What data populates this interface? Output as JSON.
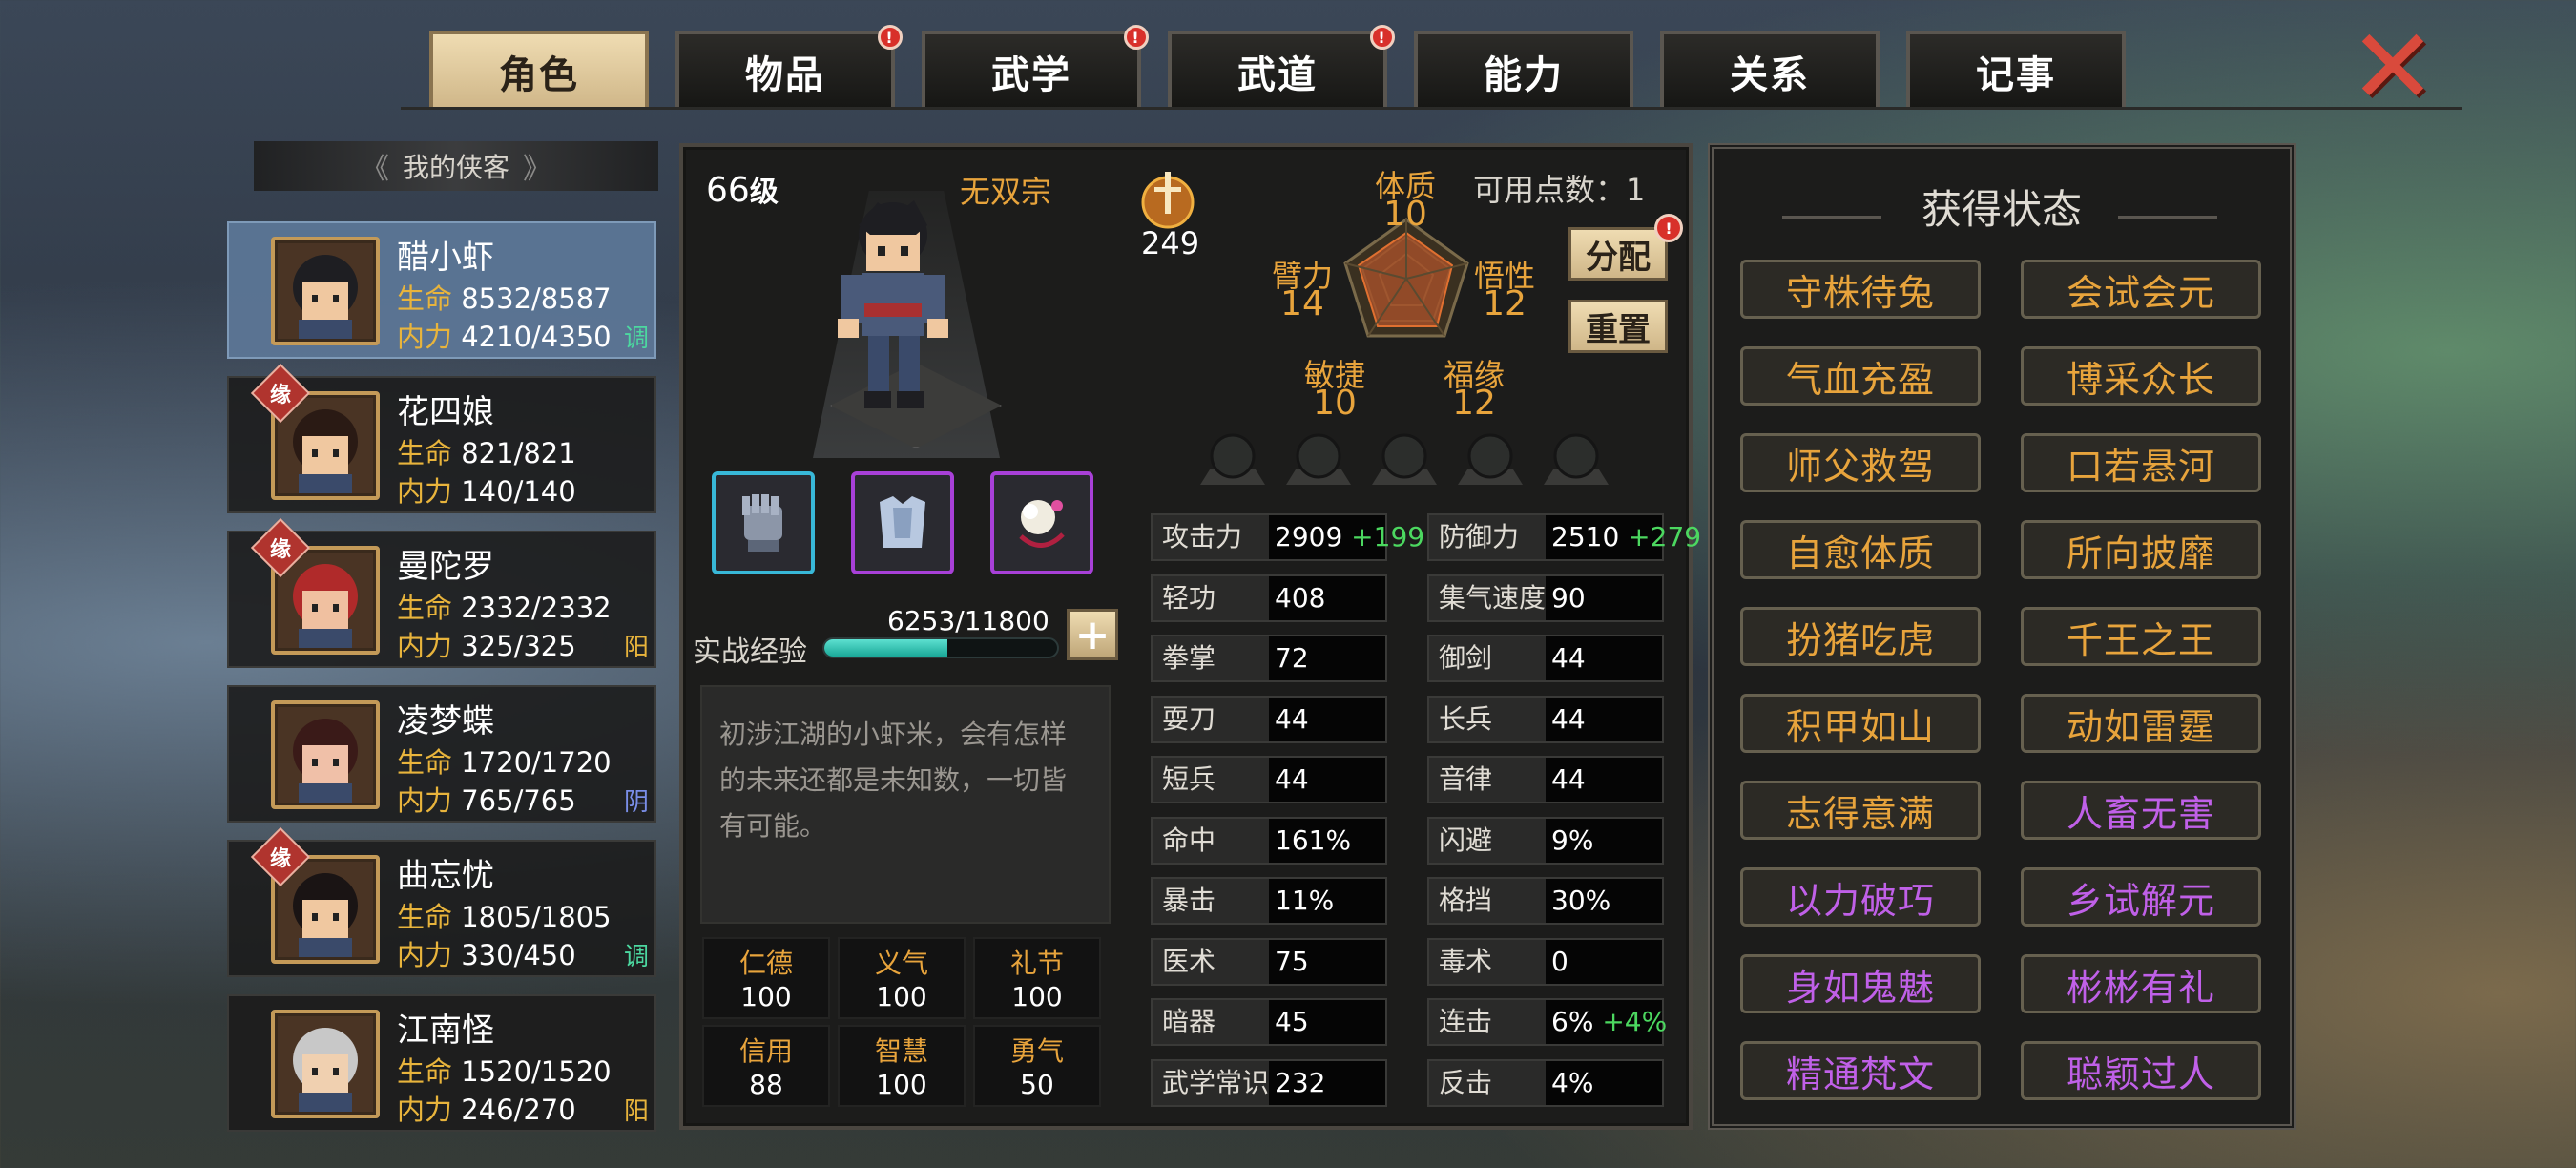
{
  "tabs": [
    {
      "label": "角色",
      "active": true,
      "badge": false
    },
    {
      "label": "物品",
      "active": false,
      "badge": true
    },
    {
      "label": "武学",
      "active": false,
      "badge": true
    },
    {
      "label": "武道",
      "active": false,
      "badge": true
    },
    {
      "label": "能力",
      "active": false,
      "badge": false
    },
    {
      "label": "关系",
      "active": false,
      "badge": false
    },
    {
      "label": "记事",
      "active": false,
      "badge": false
    }
  ],
  "badge_mark": "!",
  "roster": {
    "header": "我的侠客",
    "hp_label": "生命",
    "mp_label": "内力",
    "fate_label": "缘",
    "characters": [
      {
        "name": "醋小虾",
        "hp": "8532/8587",
        "mp": "4210/4350",
        "tag": "调",
        "tag_color": "#4cd8a0",
        "fate": false,
        "active": true
      },
      {
        "name": "花四娘",
        "hp": "821/821",
        "mp": "140/140",
        "tag": "",
        "tag_color": "",
        "fate": true,
        "active": false
      },
      {
        "name": "曼陀罗",
        "hp": "2332/2332",
        "mp": "325/325",
        "tag": "阳",
        "tag_color": "#e8b43c",
        "fate": true,
        "active": false
      },
      {
        "name": "凌梦蝶",
        "hp": "1720/1720",
        "mp": "765/765",
        "tag": "阴",
        "tag_color": "#7a8ee8",
        "fate": false,
        "active": false
      },
      {
        "name": "曲忘忧",
        "hp": "1805/1805",
        "mp": "330/450",
        "tag": "调",
        "tag_color": "#4cd8a0",
        "fate": true,
        "active": false
      },
      {
        "name": "江南怪",
        "hp": "1520/1520",
        "mp": "246/270",
        "tag": "阳",
        "tag_color": "#e8b43c",
        "fate": false,
        "active": false
      }
    ]
  },
  "hero": {
    "level": "66",
    "level_suffix": "级",
    "sect": "无双宗",
    "power": "249",
    "points_label": "可用点数：1",
    "allocate_label": "分配",
    "reset_label": "重置",
    "stats": {
      "constitution": {
        "label": "体质",
        "value": "10"
      },
      "arm": {
        "label": "臂力",
        "value": "14"
      },
      "insight": {
        "label": "悟性",
        "value": "12"
      },
      "agility": {
        "label": "敏捷",
        "value": "10"
      },
      "luck": {
        "label": "福缘",
        "value": "12"
      }
    },
    "exp_label": "实战经验",
    "exp_text": "6253/11800",
    "exp_fraction": 0.53,
    "plus_label": "+",
    "description": "初涉江湖的小虾米，会有怎样的未来还都是未知数，一切皆有可能。",
    "virtues": [
      {
        "label": "仁德",
        "value": "100"
      },
      {
        "label": "义气",
        "value": "100"
      },
      {
        "label": "礼节",
        "value": "100"
      },
      {
        "label": "信用",
        "value": "88"
      },
      {
        "label": "智慧",
        "value": "100"
      },
      {
        "label": "勇气",
        "value": "50"
      }
    ],
    "attributes_left": [
      {
        "label": "攻击力",
        "value": "2909",
        "bonus": "+199"
      },
      {
        "label": "轻功",
        "value": "408",
        "bonus": ""
      },
      {
        "label": "拳掌",
        "value": "72",
        "bonus": ""
      },
      {
        "label": "耍刀",
        "value": "44",
        "bonus": ""
      },
      {
        "label": "短兵",
        "value": "44",
        "bonus": ""
      },
      {
        "label": "命中",
        "value": "161%",
        "bonus": ""
      },
      {
        "label": "暴击",
        "value": "11%",
        "bonus": ""
      },
      {
        "label": "医术",
        "value": "75",
        "bonus": ""
      },
      {
        "label": "暗器",
        "value": "45",
        "bonus": ""
      },
      {
        "label": "武学常识",
        "value": "232",
        "bonus": ""
      }
    ],
    "attributes_right": [
      {
        "label": "防御力",
        "value": "2510",
        "bonus": "+279"
      },
      {
        "label": "集气速度",
        "value": "90",
        "bonus": ""
      },
      {
        "label": "御剑",
        "value": "44",
        "bonus": ""
      },
      {
        "label": "长兵",
        "value": "44",
        "bonus": ""
      },
      {
        "label": "音律",
        "value": "44",
        "bonus": ""
      },
      {
        "label": "闪避",
        "value": "9%",
        "bonus": ""
      },
      {
        "label": "格挡",
        "value": "30%",
        "bonus": ""
      },
      {
        "label": "毒术",
        "value": "0",
        "bonus": ""
      },
      {
        "label": "连击",
        "value": "6%",
        "bonus": "+4%"
      },
      {
        "label": "反击",
        "value": "4%",
        "bonus": ""
      }
    ]
  },
  "status_panel": {
    "title": "获得状态",
    "buffs": [
      {
        "label": "守株待兔",
        "color": "#e8a43c"
      },
      {
        "label": "会试会元",
        "color": "#e8a43c"
      },
      {
        "label": "气血充盈",
        "color": "#e8a43c"
      },
      {
        "label": "博采众长",
        "color": "#e8a43c"
      },
      {
        "label": "师父救驾",
        "color": "#e8a43c"
      },
      {
        "label": "口若悬河",
        "color": "#e8a43c"
      },
      {
        "label": "自愈体质",
        "color": "#e8a43c"
      },
      {
        "label": "所向披靡",
        "color": "#e8a43c"
      },
      {
        "label": "扮猪吃虎",
        "color": "#e8a43c"
      },
      {
        "label": "千王之王",
        "color": "#e8a43c"
      },
      {
        "label": "积甲如山",
        "color": "#e8a43c"
      },
      {
        "label": "动如雷霆",
        "color": "#e8a43c"
      },
      {
        "label": "志得意满",
        "color": "#e8a43c"
      },
      {
        "label": "人畜无害",
        "color": "#c060e8"
      },
      {
        "label": "以力破巧",
        "color": "#c060e8"
      },
      {
        "label": "乡试解元",
        "color": "#c060e8"
      },
      {
        "label": "身如鬼魅",
        "color": "#c060e8"
      },
      {
        "label": "彬彬有礼",
        "color": "#c060e8"
      },
      {
        "label": "精通梵文",
        "color": "#c060e8"
      },
      {
        "label": "聪颖过人",
        "color": "#c060e8"
      }
    ]
  },
  "close_label": "✕"
}
